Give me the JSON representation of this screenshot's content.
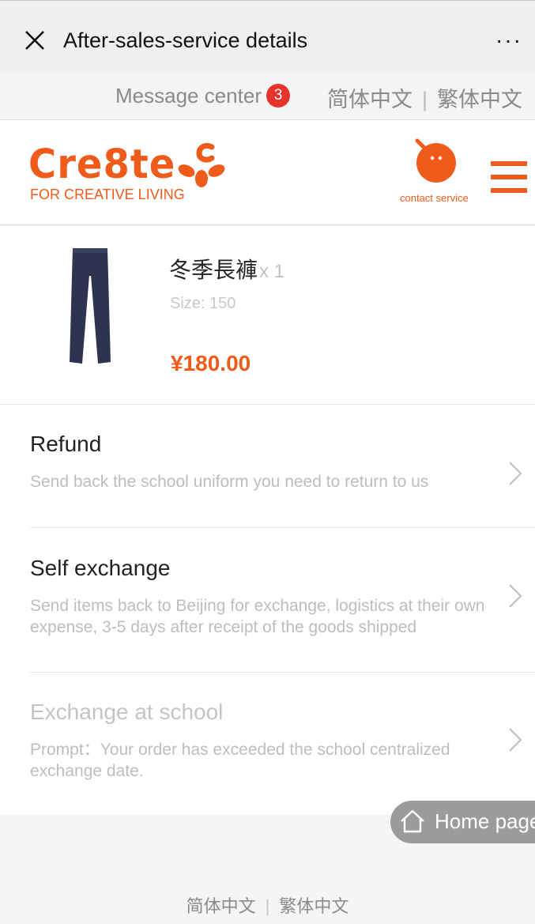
{
  "window": {
    "title": "After-sales-service details",
    "close_icon": "close-icon",
    "more_label": "···"
  },
  "message_bar": {
    "label": "Message center",
    "badge_count": "3",
    "lang_simplified": "简体中文",
    "lang_separator": "|",
    "lang_traditional": "繁体中文"
  },
  "brand": {
    "name": "Cre8te",
    "tagline": "FOR CREATIVE LIVING",
    "contact_label": "contact service",
    "accent_color": "#ef5b1a"
  },
  "product": {
    "name": "冬季長褲",
    "quantity": "x 1",
    "size": "Size: 150",
    "price": "¥180.00"
  },
  "options": [
    {
      "title": "Refund",
      "description": "Send back the school uniform you need to return to us",
      "enabled": true
    },
    {
      "title": "Self exchange",
      "description": "Send items back to Beijing for exchange, logistics at their own expense, 3-5 days after receipt of the goods shipped",
      "enabled": true
    },
    {
      "title": "Exchange at school",
      "description": "Prompt：Your order has exceeded the school centralized exchange date.",
      "enabled": false
    }
  ],
  "floating": {
    "home_label": "Home page"
  },
  "footer": {
    "lang_simplified": "简体中文",
    "lang_separator": "|",
    "lang_traditional": "繁体中文"
  }
}
